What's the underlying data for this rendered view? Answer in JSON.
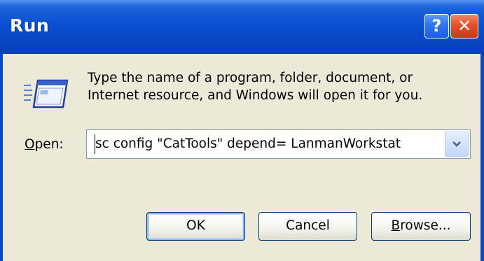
{
  "window": {
    "title": "Run",
    "help_glyph": "?",
    "close_glyph": "✕"
  },
  "content": {
    "description_line1": "Type the name of a program, folder, document, or",
    "description_line2": "Internet resource, and Windows will open it for you.",
    "icon": "run-icon"
  },
  "open_field": {
    "label_accel": "O",
    "label_rest": "pen:",
    "value": "sc config \"CatTools\" depend= LanmanWorkstat"
  },
  "buttons": {
    "ok_label": "OK",
    "cancel_label": "Cancel",
    "browse_accel": "B",
    "browse_rest": "rowse..."
  },
  "colors": {
    "titlebar": "#0a4fd0",
    "dialog_face": "#ece9d8",
    "close_button": "#e2502d"
  }
}
